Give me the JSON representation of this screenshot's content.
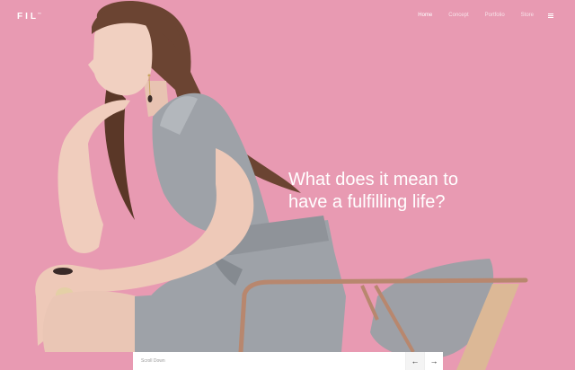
{
  "brand": {
    "logo": "FIL",
    "logo_mark": "™"
  },
  "nav": {
    "items": [
      {
        "label": "Home",
        "active": true
      },
      {
        "label": "Concept",
        "active": false
      },
      {
        "label": "Portfolio",
        "active": false
      },
      {
        "label": "Store",
        "active": false
      }
    ],
    "menu_icon": "hamburger-icon"
  },
  "hero": {
    "headline_line1": "What does it mean to",
    "headline_line2": "have a fulfilling life?",
    "image": "model-seated-on-chair-photo"
  },
  "bottom_bar": {
    "scroll_label": "Scroll Down",
    "prev_icon": "arrow-left-icon",
    "next_icon": "arrow-right-icon",
    "prev_glyph": "←",
    "next_glyph": "→"
  },
  "colors": {
    "background": "#e89ab2",
    "text": "#ffffff"
  }
}
